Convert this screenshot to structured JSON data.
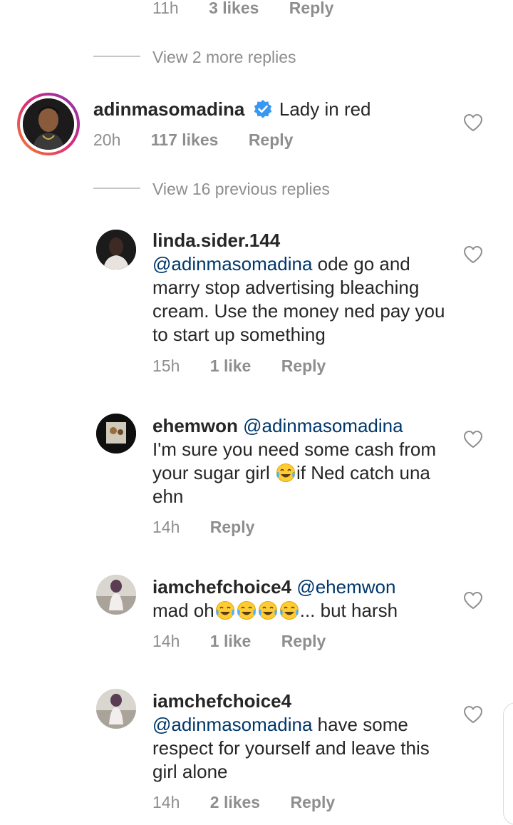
{
  "top_meta": {
    "time": "11h",
    "likes": "3 likes",
    "reply": "Reply"
  },
  "view_more_replies": "View 2 more replies",
  "parent_comment": {
    "username": "adinmasomadina",
    "verified_icon": "verified-badge-icon",
    "text": "Lady in red",
    "time": "20h",
    "likes": "117 likes",
    "reply": "Reply"
  },
  "view_previous_replies": "View 16 previous replies",
  "replies": [
    {
      "username": "linda.sider.144",
      "mention": "@adinmasomadina",
      "text": "ode go and marry stop advertising bleaching cream. Use the money ned pay you to start up something",
      "time": "15h",
      "likes": "1 like",
      "reply": "Reply"
    },
    {
      "username": "ehemwon",
      "mention": "@adinmasomadina",
      "text_a": "I'm sure you need some cash from your sugar girl",
      "text_b": "if Ned catch una ehn",
      "time": "14h",
      "reply": "Reply"
    },
    {
      "username": "iamchefchoice4",
      "mention": "@ehemwon",
      "text_a": "mad oh",
      "text_b": "... but harsh",
      "time": "14h",
      "likes": "1 like",
      "reply": "Reply"
    },
    {
      "username": "iamchefchoice4",
      "mention": "@adinmasomadina",
      "text": "have some respect for yourself and leave this girl alone",
      "time": "14h",
      "likes": "2 likes",
      "reply": "Reply"
    }
  ],
  "colors": {
    "mention": "#00376b",
    "verified": "#3897f0",
    "muted": "#8e8e8e",
    "story_ring_start": "#f58529",
    "story_ring_end": "#dd2a7b"
  }
}
